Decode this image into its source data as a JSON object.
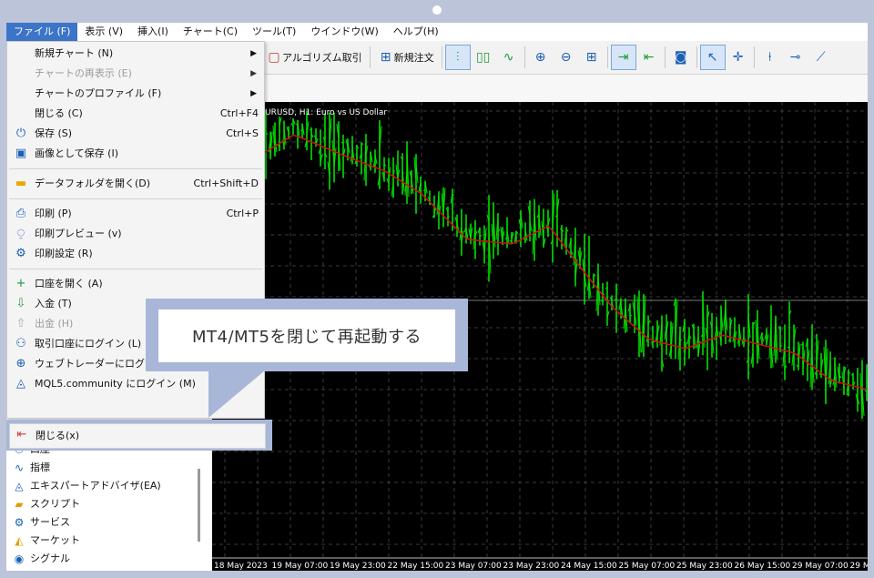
{
  "menubar": {
    "items": [
      "ファイル (F)",
      "表示 (V)",
      "挿入(I)",
      "チャート(C)",
      "ツール(T)",
      "ウインドウ(W)",
      "ヘルプ(H)"
    ]
  },
  "toolbar": {
    "algo_label": "アルゴリズム取引",
    "new_order_label": "新規注文"
  },
  "file_menu": {
    "items": [
      {
        "label": "新規チャート (N)",
        "shortcut": "",
        "submenu": true,
        "disabled": false,
        "icon": ""
      },
      {
        "label": "チャートの再表示 (E)",
        "shortcut": "",
        "submenu": true,
        "disabled": true,
        "icon": ""
      },
      {
        "label": "チャートのプロファイル (F)",
        "shortcut": "",
        "submenu": true,
        "disabled": false,
        "icon": ""
      },
      {
        "label": "閉じる (C)",
        "shortcut": "Ctrl+F4",
        "submenu": false,
        "disabled": false,
        "icon": ""
      },
      {
        "label": "保存 (S)",
        "shortcut": "Ctrl+S",
        "submenu": false,
        "disabled": false,
        "icon": "save-icon"
      },
      {
        "label": "画像として保存 (I)",
        "shortcut": "",
        "submenu": false,
        "disabled": false,
        "icon": "image-icon"
      },
      {
        "label": "データフォルダを開く(D)",
        "shortcut": "Ctrl+Shift+D",
        "submenu": false,
        "disabled": false,
        "icon": "folder-icon"
      },
      {
        "label": "印刷 (P)",
        "shortcut": "Ctrl+P",
        "submenu": false,
        "disabled": false,
        "icon": "printer-icon"
      },
      {
        "label": "印刷プレビュー (v)",
        "shortcut": "",
        "submenu": false,
        "disabled": false,
        "icon": "print-preview-icon"
      },
      {
        "label": "印刷設定 (R)",
        "shortcut": "",
        "submenu": false,
        "disabled": false,
        "icon": "print-settings-icon"
      },
      {
        "label": "口座を開く (A)",
        "shortcut": "",
        "submenu": false,
        "disabled": false,
        "icon": "plus-icon"
      },
      {
        "label": "入金 (T)",
        "shortcut": "",
        "submenu": false,
        "disabled": false,
        "icon": "deposit-icon"
      },
      {
        "label": "出金 (H)",
        "shortcut": "",
        "submenu": false,
        "disabled": true,
        "icon": "withdraw-icon"
      },
      {
        "label": "取引口座にログイン (L)",
        "shortcut": "",
        "submenu": false,
        "disabled": false,
        "icon": "user-icon"
      },
      {
        "label": "ウェブトレーダーにログイン (W)",
        "shortcut": "",
        "submenu": false,
        "disabled": false,
        "icon": "globe-icon"
      },
      {
        "label": "MQL5.community にログイン (M)",
        "shortcut": "",
        "submenu": false,
        "disabled": false,
        "icon": "mql5-icon"
      }
    ],
    "exit_label": "閉じる(x)"
  },
  "callout": {
    "text": "MT4/MT5を閉じて再起動する"
  },
  "navigator": {
    "items": [
      {
        "label": "口座",
        "icon": "accounts-icon"
      },
      {
        "label": "指標",
        "icon": "indicator-icon"
      },
      {
        "label": "エキスパートアドバイザ(EA)",
        "icon": "expert-icon"
      },
      {
        "label": "スクリプト",
        "icon": "script-icon"
      },
      {
        "label": "サービス",
        "icon": "service-icon"
      },
      {
        "label": "マーケット",
        "icon": "market-icon"
      },
      {
        "label": "シグナル",
        "icon": "signal-icon"
      }
    ]
  },
  "chart": {
    "title": "URUSD, H1:  Euro vs US Dollar",
    "x_labels": [
      "18 May 2023",
      "19 May 07:00",
      "19 May 23:00",
      "22 May 15:00",
      "23 May 07:00",
      "23 May 23:00",
      "24 May 15:00",
      "25 May 07:00",
      "25 May 23:00",
      "26 May 15:00",
      "29 May 07:00",
      "29 M"
    ],
    "colors": {
      "bars": "#00e000",
      "ma": "#d01010",
      "grid": "#3a3a3a",
      "background": "#000000"
    }
  }
}
